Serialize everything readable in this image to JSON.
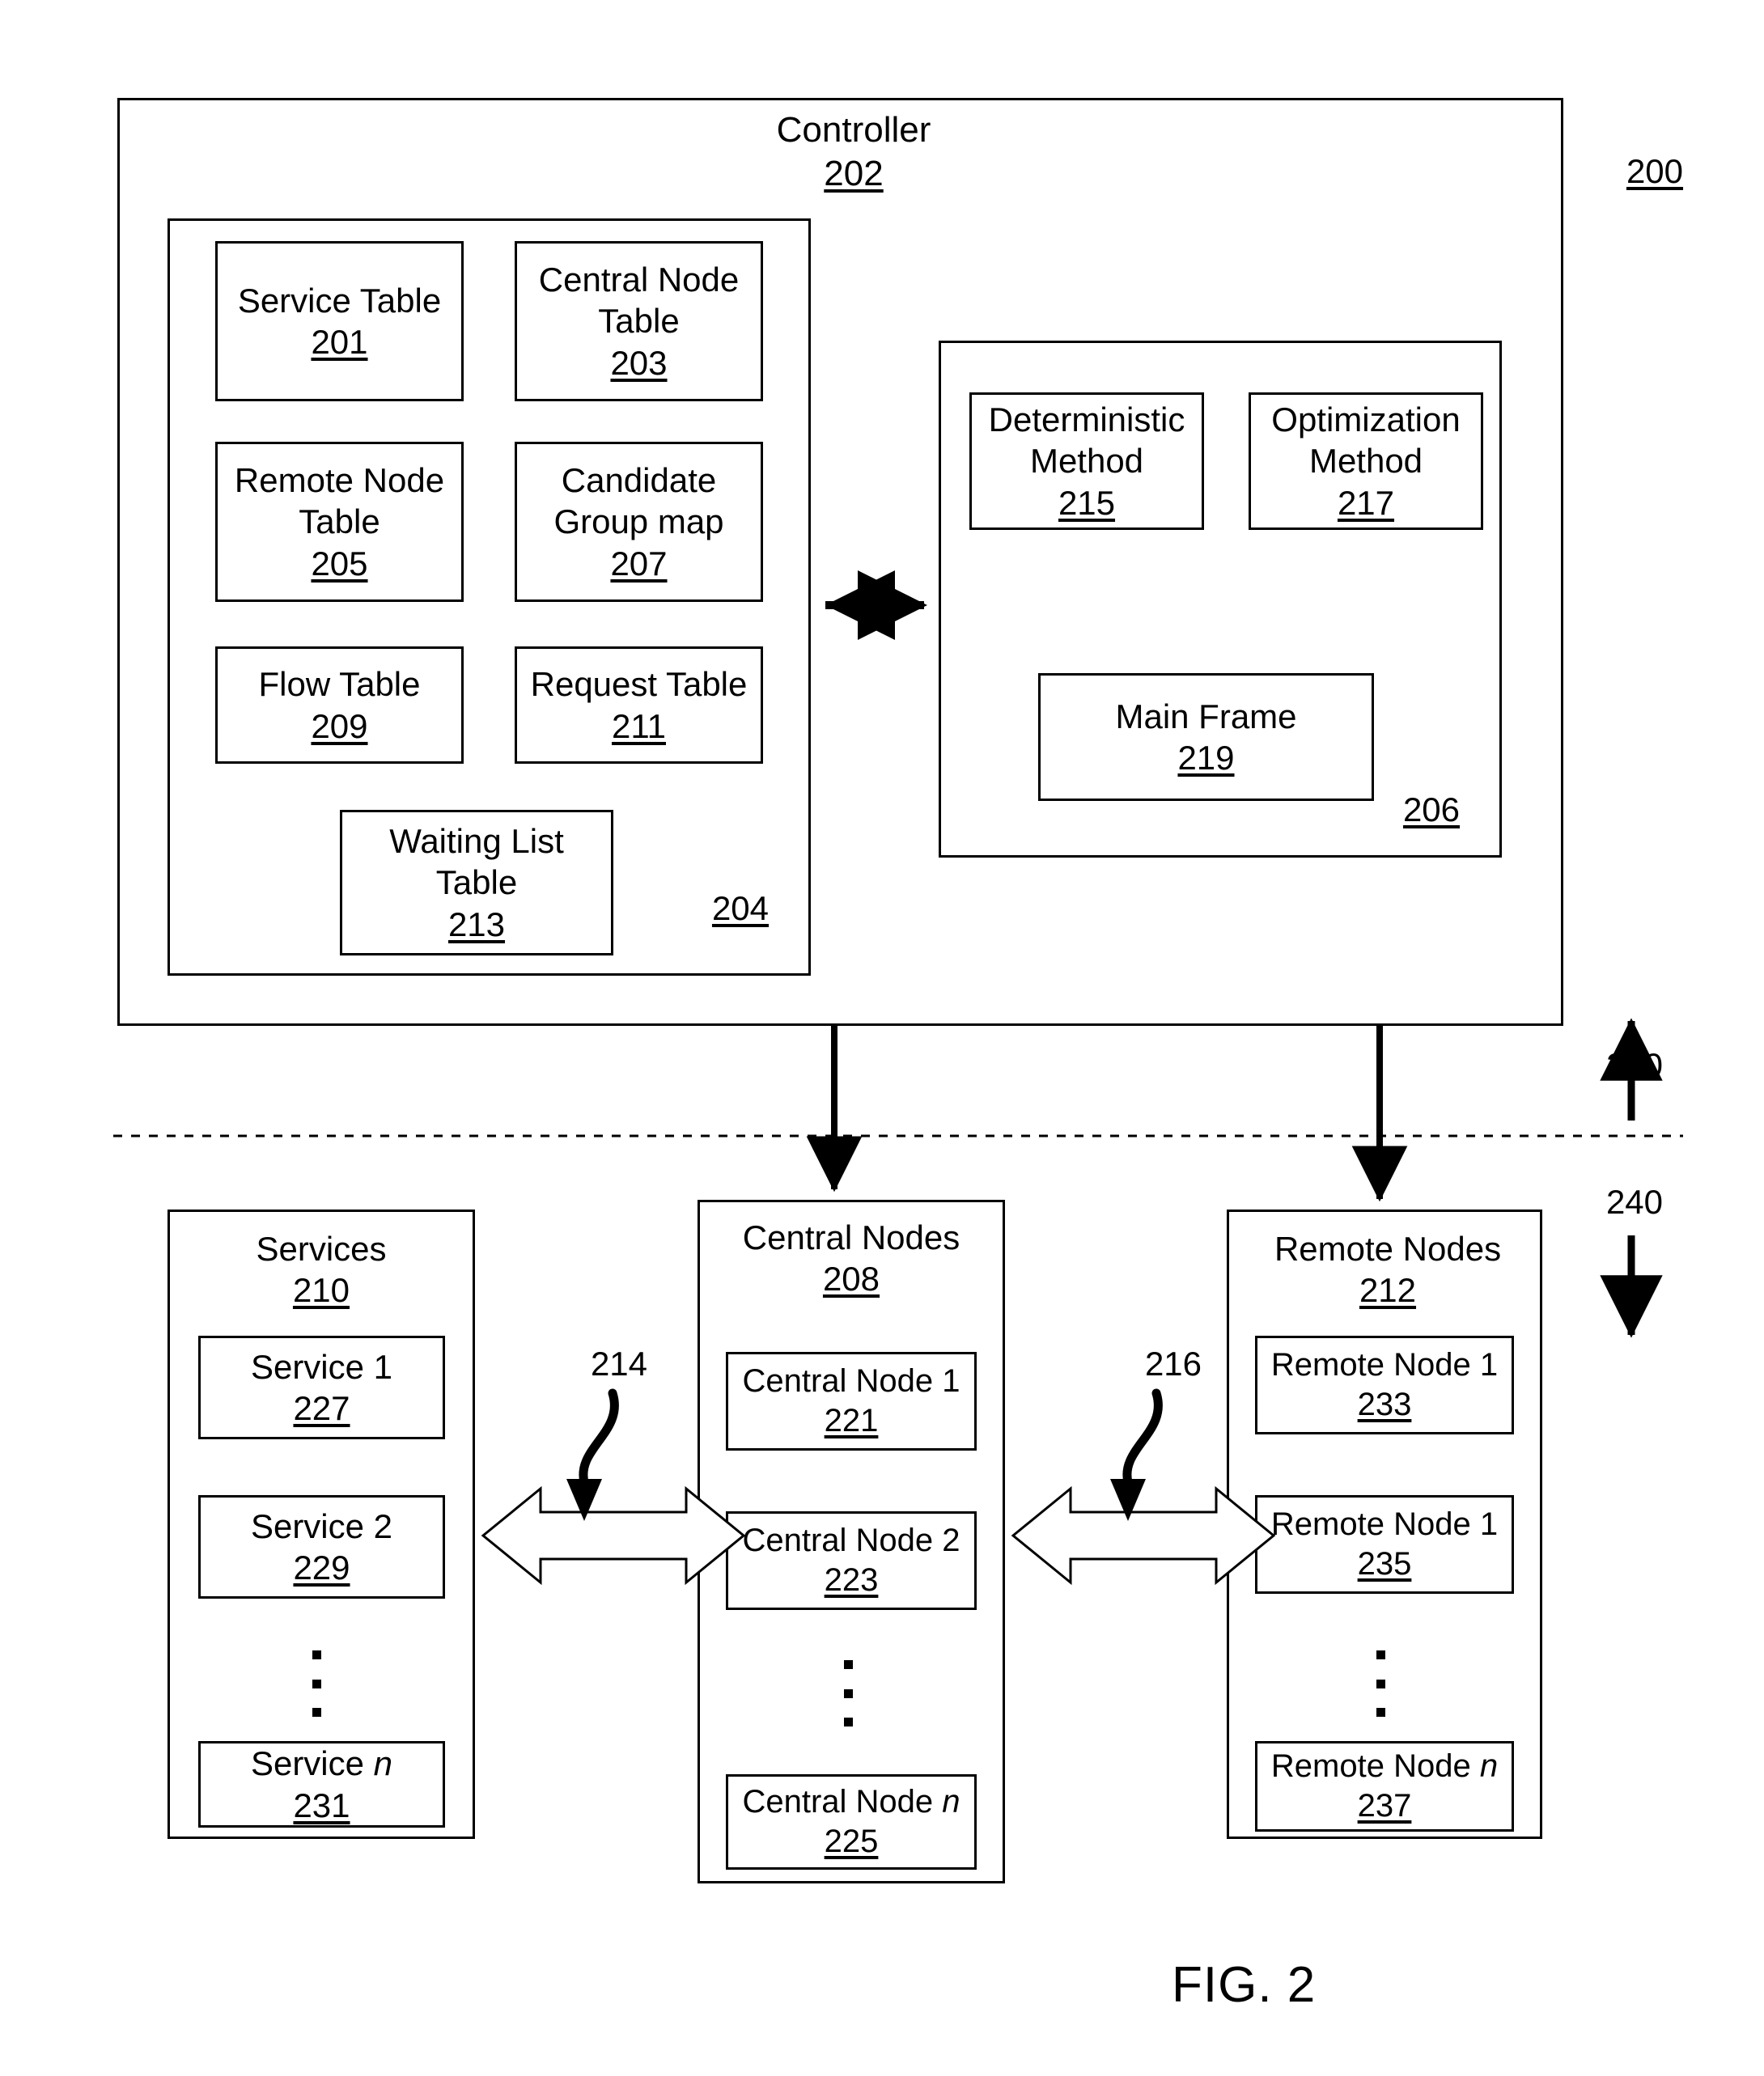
{
  "figure": {
    "caption": "FIG. 2",
    "system_ref": "200",
    "control_plane_ref": "230",
    "data_plane_ref": "240"
  },
  "controller": {
    "title": "Controller",
    "ref": "202",
    "tables_group": {
      "ref": "204",
      "items": [
        {
          "label": "Service Table",
          "ref": "201"
        },
        {
          "label_line1": "Central Node",
          "label_line2": "Table",
          "ref": "203"
        },
        {
          "label_line1": "Remote Node",
          "label_line2": "Table",
          "ref": "205"
        },
        {
          "label_line1": "Candidate",
          "label_line2": "Group map",
          "ref": "207"
        },
        {
          "label": "Flow Table",
          "ref": "209"
        },
        {
          "label": "Request Table",
          "ref": "211"
        },
        {
          "label_line1": "Waiting List",
          "label_line2": "Table",
          "ref": "213"
        }
      ]
    },
    "methods_group": {
      "ref": "206",
      "items": [
        {
          "label_line1": "Deterministic",
          "label_line2": "Method",
          "ref": "215"
        },
        {
          "label_line1": "Optimization",
          "label_line2": "Method",
          "ref": "217"
        },
        {
          "label": "Main Frame",
          "ref": "219"
        }
      ]
    }
  },
  "services": {
    "title": "Services",
    "ref": "210",
    "items": [
      {
        "label": "Service 1",
        "ref": "227"
      },
      {
        "label": "Service 2",
        "ref": "229"
      },
      {
        "label_prefix": "Service ",
        "label_italic": "n",
        "ref": "231"
      }
    ]
  },
  "central_nodes": {
    "title": "Central Nodes",
    "ref": "208",
    "items": [
      {
        "label": "Central Node 1",
        "ref": "221"
      },
      {
        "label": "Central Node 2",
        "ref": "223"
      },
      {
        "label_prefix": "Central Node ",
        "label_italic": "n",
        "ref": "225"
      }
    ]
  },
  "remote_nodes": {
    "title": "Remote Nodes",
    "ref": "212",
    "items": [
      {
        "label": "Remote Node 1",
        "ref": "233"
      },
      {
        "label": "Remote Node 1",
        "ref": "235"
      },
      {
        "label_prefix": "Remote Node ",
        "label_italic": "n",
        "ref": "237"
      }
    ]
  },
  "connectors": {
    "services_to_central_ref": "214",
    "central_to_remote_ref": "216"
  },
  "colors": {
    "stroke": "#000000",
    "background": "#ffffff"
  }
}
